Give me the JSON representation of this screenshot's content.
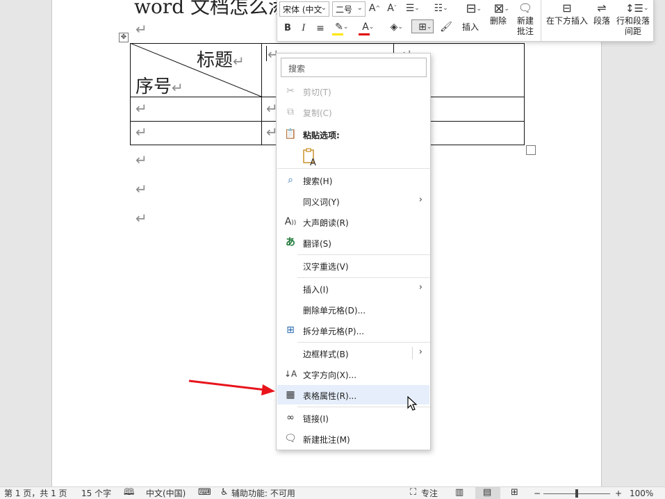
{
  "document": {
    "title": "word 文档怎么添",
    "table": {
      "diag_header_top": "标题",
      "diag_header_bottom": "序号"
    }
  },
  "mini_toolbar": {
    "font_name": "宋体 (中文",
    "font_size": "二号",
    "bold": "B",
    "italic": "I",
    "font_color_letter": "A",
    "insert_label": "插入",
    "delete_label": "删除",
    "new_comment_line1": "新建",
    "new_comment_line2": "批注",
    "insert_below_label": "在下方插入",
    "paragraph_label": "段落",
    "line_spacing_line1": "行和段落",
    "line_spacing_line2": "间距",
    "highlight_color": "#ffe600",
    "font_color": "#e00000"
  },
  "context_menu": {
    "search_placeholder": "搜索",
    "items": [
      {
        "label": "剪切(T)",
        "icon": "scissors-icon",
        "disabled": true
      },
      {
        "label": "复制(C)",
        "icon": "copy-icon",
        "disabled": true
      },
      {
        "label": "粘贴选项:",
        "icon": "clipboard-icon"
      },
      {
        "label": "搜索(H)",
        "icon": "search-icon"
      },
      {
        "label": "同义词(Y)",
        "icon": "",
        "submenu": true
      },
      {
        "label": "大声朗读(R)",
        "icon": "read-aloud-icon"
      },
      {
        "label": "翻译(S)",
        "icon": "translate-icon"
      },
      {
        "label": "汉字重选(V)",
        "icon": ""
      },
      {
        "label": "插入(I)",
        "icon": "",
        "submenu": true
      },
      {
        "label": "删除单元格(D)...",
        "icon": ""
      },
      {
        "label": "拆分单元格(P)...",
        "icon": "split-cells-icon"
      },
      {
        "label": "边框样式(B)",
        "icon": "",
        "submenu": true
      },
      {
        "label": "文字方向(X)...",
        "icon": "text-direction-icon"
      },
      {
        "label": "表格属性(R)...",
        "icon": "table-properties-icon",
        "highlighted": true
      },
      {
        "label": "链接(I)",
        "icon": "link-icon"
      },
      {
        "label": "新建批注(M)",
        "icon": "new-comment-icon"
      }
    ]
  },
  "status_bar": {
    "page_info": "第 1 页，共 1 页",
    "word_count": "15 个字",
    "language": "中文(中国)",
    "accessibility": "辅助功能: 不可用",
    "focus": "专注",
    "zoom_minus": "−",
    "zoom_plus": "+",
    "zoom_level": "100%"
  },
  "colors": {
    "arrow": "#e8141c",
    "menu_highlight": "#e5eefa"
  }
}
